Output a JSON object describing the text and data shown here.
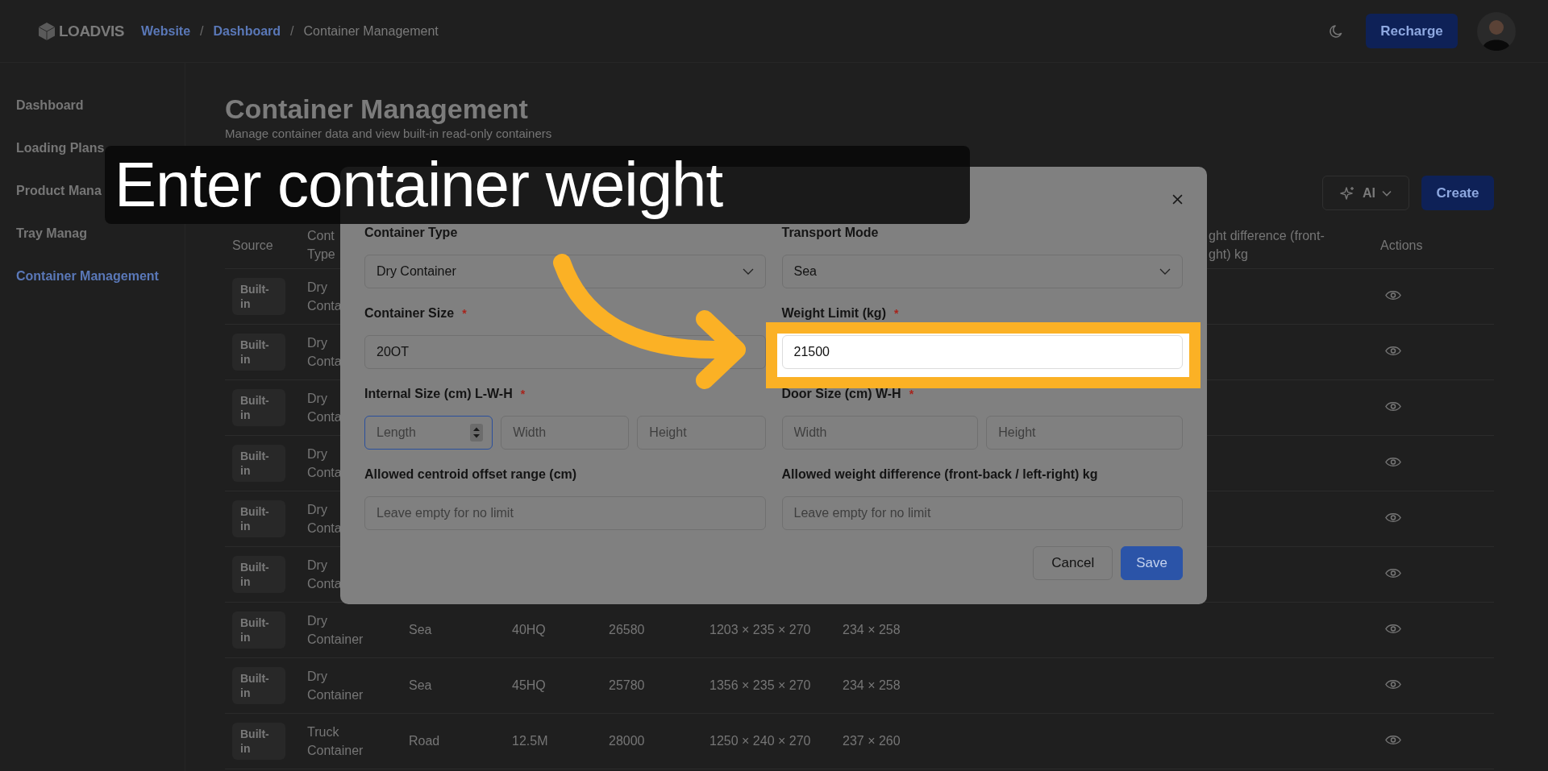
{
  "header": {
    "logo": "LOADVIS",
    "separator": "/",
    "breadcrumbs": [
      {
        "label": "Website",
        "kind": "link"
      },
      {
        "label": "Dashboard",
        "kind": "link"
      },
      {
        "label": "Container Management",
        "kind": "current"
      }
    ],
    "recharge_button": "Recharge"
  },
  "sidebar": {
    "items": [
      {
        "label": "Dashboard",
        "selected": false
      },
      {
        "label": "Loading Plans",
        "selected": false
      },
      {
        "label": "Product Mana",
        "selected": false
      },
      {
        "label": "Tray Manag",
        "selected": false
      },
      {
        "label": "Container Management",
        "selected": true
      }
    ]
  },
  "page": {
    "title": "Container Management",
    "subtitle": "Manage container data and view built-in read-only containers"
  },
  "toolbar": {
    "ai_button": "AI",
    "create_button": "Create"
  },
  "table": {
    "columns": [
      {
        "label": "Source",
        "kind": "source"
      },
      {
        "label": "Cont Type",
        "kind": "type"
      },
      {
        "label": "ght difference (front- ght) kg",
        "kind": "weight_difference"
      },
      {
        "label": "Actions",
        "kind": "actions"
      }
    ],
    "rows": [
      {
        "source": "Built-in",
        "type": "Dry Conta"
      },
      {
        "source": "Built-in",
        "type": "Dry Conta"
      },
      {
        "source": "Built-in",
        "type": "Dry Conta"
      },
      {
        "source": "Built-in",
        "type": "Dry Conta"
      },
      {
        "source": "Built-in",
        "type": "Dry Conta"
      },
      {
        "source": "Built-in",
        "type": "Dry Conta"
      },
      {
        "source": "Built-in",
        "type": "Dry Container",
        "transport": "Sea",
        "size": "40HQ",
        "weight_limit": "26580",
        "internal_size": "1203 × 235 × 270",
        "door_size": "234 × 258"
      },
      {
        "source": "Built-in",
        "type": "Dry Container",
        "transport": "Sea",
        "size": "45HQ",
        "weight_limit": "25780",
        "internal_size": "1356 × 235 × 270",
        "door_size": "234 × 258"
      },
      {
        "source": "Built-in",
        "type": "Truck Container",
        "transport": "Road",
        "size": "12.5M",
        "weight_limit": "28000",
        "internal_size": "1250 × 240 × 270",
        "door_size": "237 × 260"
      }
    ]
  },
  "modal": {
    "fields": [
      {
        "kind": "select",
        "label": "Container Type",
        "value": "Dry Container"
      },
      {
        "kind": "select",
        "label": "Transport Mode",
        "value": "Sea"
      },
      {
        "kind": "text",
        "label": "Container Size",
        "required_mark": "*",
        "value": "20OT"
      },
      {
        "kind": "text",
        "label": "Weight Limit (kg)",
        "required_mark": "*",
        "value": "21500",
        "highlighted": true
      },
      {
        "kind": "group",
        "label": "Internal Size (cm) L-W-H",
        "required_mark": "*",
        "inputs": [
          {
            "placeholder": "Length",
            "focused": true
          },
          {
            "placeholder": "Width",
            "focused": false
          },
          {
            "placeholder": "Height",
            "focused": false
          }
        ]
      },
      {
        "kind": "group",
        "label": "Door Size (cm) W-H",
        "required_mark": "*",
        "inputs": [
          {
            "placeholder": "Width",
            "focused": false
          },
          {
            "placeholder": "Height",
            "focused": false
          }
        ]
      },
      {
        "kind": "text",
        "label": "Allowed centroid offset range (cm)",
        "placeholder": "Leave empty for no limit"
      },
      {
        "kind": "text",
        "label": "Allowed weight difference (front-back / left-right) kg",
        "placeholder": "Leave empty for no limit"
      }
    ],
    "buttons": [
      {
        "label": "Cancel",
        "kind": "secondary"
      },
      {
        "label": "Save",
        "kind": "primary"
      }
    ]
  },
  "annotation": {
    "caption": "Enter container weight"
  }
}
